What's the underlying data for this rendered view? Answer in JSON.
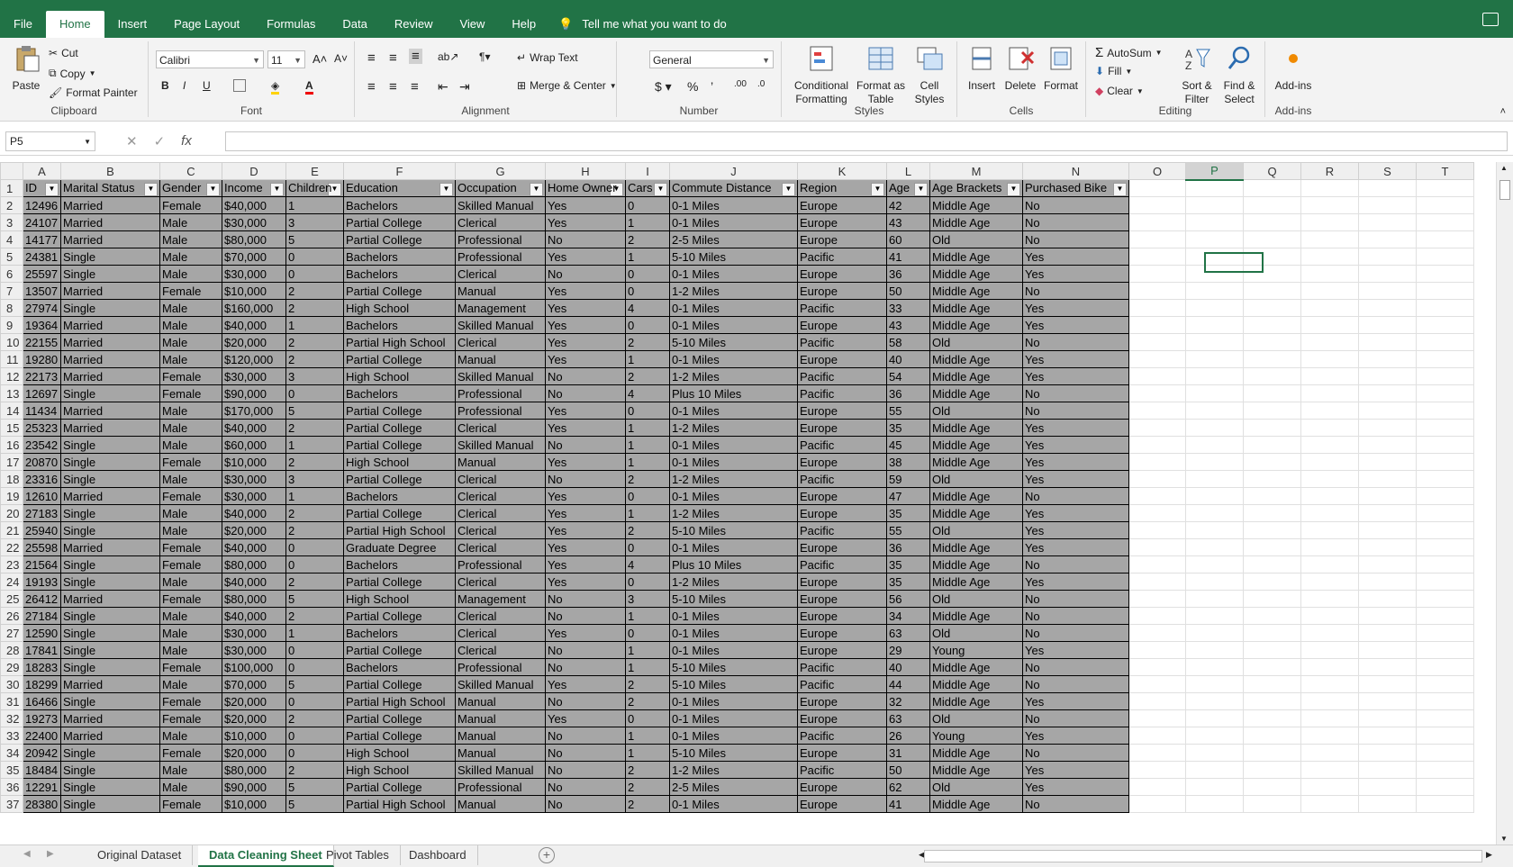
{
  "tabs": [
    "File",
    "Home",
    "Insert",
    "Page Layout",
    "Formulas",
    "Data",
    "Review",
    "View",
    "Help"
  ],
  "active_tab": "Home",
  "tell_me": "Tell me what you want to do",
  "ribbon": {
    "clipboard": {
      "paste": "Paste",
      "cut": "Cut",
      "copy": "Copy",
      "format_painter": "Format Painter",
      "label": "Clipboard"
    },
    "font": {
      "name": "Calibri",
      "size": "11",
      "bold": "B",
      "italic": "I",
      "underline": "U",
      "label": "Font"
    },
    "alignment": {
      "wrap": "Wrap Text",
      "merge": "Merge & Center",
      "label": "Alignment"
    },
    "number": {
      "format": "General",
      "label": "Number"
    },
    "styles": {
      "conditional": [
        "Conditional",
        "Formatting"
      ],
      "format_table": [
        "Format as",
        "Table"
      ],
      "cell_styles": [
        "Cell",
        "Styles"
      ],
      "label": "Styles"
    },
    "cells": {
      "insert": "Insert",
      "delete": "Delete",
      "format": "Format",
      "label": "Cells"
    },
    "editing": {
      "autosum": "AutoSum",
      "fill": "Fill",
      "clear": "Clear",
      "sort": [
        "Sort &",
        "Filter"
      ],
      "find": [
        "Find &",
        "Select"
      ],
      "label": "Editing"
    },
    "addins": {
      "btn": "Add-ins",
      "label": "Add-ins"
    }
  },
  "name_box": "P5",
  "columns": [
    "A",
    "B",
    "C",
    "D",
    "E",
    "F",
    "G",
    "H",
    "I",
    "J",
    "K",
    "L",
    "M",
    "N",
    "O",
    "P",
    "Q",
    "R",
    "S",
    "T"
  ],
  "headers": [
    "ID",
    "Marital Status",
    "Gender",
    "Income",
    "Children",
    "Education",
    "Occupation",
    "Home Owner",
    "Cars",
    "Commute Distance",
    "Region",
    "Age",
    "Age Brackets",
    "Purchased Bike"
  ],
  "rows": [
    [
      "12496",
      "Married",
      "Female",
      "$40,000",
      "1",
      "Bachelors",
      "Skilled Manual",
      "Yes",
      "0",
      "0-1 Miles",
      "Europe",
      "42",
      "Middle Age",
      "No"
    ],
    [
      "24107",
      "Married",
      "Male",
      "$30,000",
      "3",
      "Partial College",
      "Clerical",
      "Yes",
      "1",
      "0-1 Miles",
      "Europe",
      "43",
      "Middle Age",
      "No"
    ],
    [
      "14177",
      "Married",
      "Male",
      "$80,000",
      "5",
      "Partial College",
      "Professional",
      "No",
      "2",
      "2-5 Miles",
      "Europe",
      "60",
      "Old",
      "No"
    ],
    [
      "24381",
      "Single",
      "Male",
      "$70,000",
      "0",
      "Bachelors",
      "Professional",
      "Yes",
      "1",
      "5-10 Miles",
      "Pacific",
      "41",
      "Middle Age",
      "Yes"
    ],
    [
      "25597",
      "Single",
      "Male",
      "$30,000",
      "0",
      "Bachelors",
      "Clerical",
      "No",
      "0",
      "0-1 Miles",
      "Europe",
      "36",
      "Middle Age",
      "Yes"
    ],
    [
      "13507",
      "Married",
      "Female",
      "$10,000",
      "2",
      "Partial College",
      "Manual",
      "Yes",
      "0",
      "1-2 Miles",
      "Europe",
      "50",
      "Middle Age",
      "No"
    ],
    [
      "27974",
      "Single",
      "Male",
      "$160,000",
      "2",
      "High School",
      "Management",
      "Yes",
      "4",
      "0-1 Miles",
      "Pacific",
      "33",
      "Middle Age",
      "Yes"
    ],
    [
      "19364",
      "Married",
      "Male",
      "$40,000",
      "1",
      "Bachelors",
      "Skilled Manual",
      "Yes",
      "0",
      "0-1 Miles",
      "Europe",
      "43",
      "Middle Age",
      "Yes"
    ],
    [
      "22155",
      "Married",
      "Male",
      "$20,000",
      "2",
      "Partial High School",
      "Clerical",
      "Yes",
      "2",
      "5-10 Miles",
      "Pacific",
      "58",
      "Old",
      "No"
    ],
    [
      "19280",
      "Married",
      "Male",
      "$120,000",
      "2",
      "Partial College",
      "Manual",
      "Yes",
      "1",
      "0-1 Miles",
      "Europe",
      "40",
      "Middle Age",
      "Yes"
    ],
    [
      "22173",
      "Married",
      "Female",
      "$30,000",
      "3",
      "High School",
      "Skilled Manual",
      "No",
      "2",
      "1-2 Miles",
      "Pacific",
      "54",
      "Middle Age",
      "Yes"
    ],
    [
      "12697",
      "Single",
      "Female",
      "$90,000",
      "0",
      "Bachelors",
      "Professional",
      "No",
      "4",
      "Plus 10 Miles",
      "Pacific",
      "36",
      "Middle Age",
      "No"
    ],
    [
      "11434",
      "Married",
      "Male",
      "$170,000",
      "5",
      "Partial College",
      "Professional",
      "Yes",
      "0",
      "0-1 Miles",
      "Europe",
      "55",
      "Old",
      "No"
    ],
    [
      "25323",
      "Married",
      "Male",
      "$40,000",
      "2",
      "Partial College",
      "Clerical",
      "Yes",
      "1",
      "1-2 Miles",
      "Europe",
      "35",
      "Middle Age",
      "Yes"
    ],
    [
      "23542",
      "Single",
      "Male",
      "$60,000",
      "1",
      "Partial College",
      "Skilled Manual",
      "No",
      "1",
      "0-1 Miles",
      "Pacific",
      "45",
      "Middle Age",
      "Yes"
    ],
    [
      "20870",
      "Single",
      "Female",
      "$10,000",
      "2",
      "High School",
      "Manual",
      "Yes",
      "1",
      "0-1 Miles",
      "Europe",
      "38",
      "Middle Age",
      "Yes"
    ],
    [
      "23316",
      "Single",
      "Male",
      "$30,000",
      "3",
      "Partial College",
      "Clerical",
      "No",
      "2",
      "1-2 Miles",
      "Pacific",
      "59",
      "Old",
      "Yes"
    ],
    [
      "12610",
      "Married",
      "Female",
      "$30,000",
      "1",
      "Bachelors",
      "Clerical",
      "Yes",
      "0",
      "0-1 Miles",
      "Europe",
      "47",
      "Middle Age",
      "No"
    ],
    [
      "27183",
      "Single",
      "Male",
      "$40,000",
      "2",
      "Partial College",
      "Clerical",
      "Yes",
      "1",
      "1-2 Miles",
      "Europe",
      "35",
      "Middle Age",
      "Yes"
    ],
    [
      "25940",
      "Single",
      "Male",
      "$20,000",
      "2",
      "Partial High School",
      "Clerical",
      "Yes",
      "2",
      "5-10 Miles",
      "Pacific",
      "55",
      "Old",
      "Yes"
    ],
    [
      "25598",
      "Married",
      "Female",
      "$40,000",
      "0",
      "Graduate Degree",
      "Clerical",
      "Yes",
      "0",
      "0-1 Miles",
      "Europe",
      "36",
      "Middle Age",
      "Yes"
    ],
    [
      "21564",
      "Single",
      "Female",
      "$80,000",
      "0",
      "Bachelors",
      "Professional",
      "Yes",
      "4",
      "Plus 10 Miles",
      "Pacific",
      "35",
      "Middle Age",
      "No"
    ],
    [
      "19193",
      "Single",
      "Male",
      "$40,000",
      "2",
      "Partial College",
      "Clerical",
      "Yes",
      "0",
      "1-2 Miles",
      "Europe",
      "35",
      "Middle Age",
      "Yes"
    ],
    [
      "26412",
      "Married",
      "Female",
      "$80,000",
      "5",
      "High School",
      "Management",
      "No",
      "3",
      "5-10 Miles",
      "Europe",
      "56",
      "Old",
      "No"
    ],
    [
      "27184",
      "Single",
      "Male",
      "$40,000",
      "2",
      "Partial College",
      "Clerical",
      "No",
      "1",
      "0-1 Miles",
      "Europe",
      "34",
      "Middle Age",
      "No"
    ],
    [
      "12590",
      "Single",
      "Male",
      "$30,000",
      "1",
      "Bachelors",
      "Clerical",
      "Yes",
      "0",
      "0-1 Miles",
      "Europe",
      "63",
      "Old",
      "No"
    ],
    [
      "17841",
      "Single",
      "Male",
      "$30,000",
      "0",
      "Partial College",
      "Clerical",
      "No",
      "1",
      "0-1 Miles",
      "Europe",
      "29",
      "Young",
      "Yes"
    ],
    [
      "18283",
      "Single",
      "Female",
      "$100,000",
      "0",
      "Bachelors",
      "Professional",
      "No",
      "1",
      "5-10 Miles",
      "Pacific",
      "40",
      "Middle Age",
      "No"
    ],
    [
      "18299",
      "Married",
      "Male",
      "$70,000",
      "5",
      "Partial College",
      "Skilled Manual",
      "Yes",
      "2",
      "5-10 Miles",
      "Pacific",
      "44",
      "Middle Age",
      "No"
    ],
    [
      "16466",
      "Single",
      "Female",
      "$20,000",
      "0",
      "Partial High School",
      "Manual",
      "No",
      "2",
      "0-1 Miles",
      "Europe",
      "32",
      "Middle Age",
      "Yes"
    ],
    [
      "19273",
      "Married",
      "Female",
      "$20,000",
      "2",
      "Partial College",
      "Manual",
      "Yes",
      "0",
      "0-1 Miles",
      "Europe",
      "63",
      "Old",
      "No"
    ],
    [
      "22400",
      "Married",
      "Male",
      "$10,000",
      "0",
      "Partial College",
      "Manual",
      "No",
      "1",
      "0-1 Miles",
      "Pacific",
      "26",
      "Young",
      "Yes"
    ],
    [
      "20942",
      "Single",
      "Female",
      "$20,000",
      "0",
      "High School",
      "Manual",
      "No",
      "1",
      "5-10 Miles",
      "Europe",
      "31",
      "Middle Age",
      "No"
    ],
    [
      "18484",
      "Single",
      "Male",
      "$80,000",
      "2",
      "High School",
      "Skilled Manual",
      "No",
      "2",
      "1-2 Miles",
      "Pacific",
      "50",
      "Middle Age",
      "Yes"
    ],
    [
      "12291",
      "Single",
      "Male",
      "$90,000",
      "5",
      "Partial College",
      "Professional",
      "No",
      "2",
      "2-5 Miles",
      "Europe",
      "62",
      "Old",
      "Yes"
    ],
    [
      "28380",
      "Single",
      "Female",
      "$10,000",
      "5",
      "Partial High School",
      "Manual",
      "No",
      "2",
      "0-1 Miles",
      "Europe",
      "41",
      "Middle Age",
      "No"
    ]
  ],
  "sheet_tabs": [
    "Original Dataset",
    "Data Cleaning Sheet",
    "Pivot Tables",
    "Dashboard"
  ],
  "active_sheet": "Data Cleaning Sheet",
  "colors": {
    "excel_green": "#217346",
    "data_fill": "#a6a6a6"
  }
}
